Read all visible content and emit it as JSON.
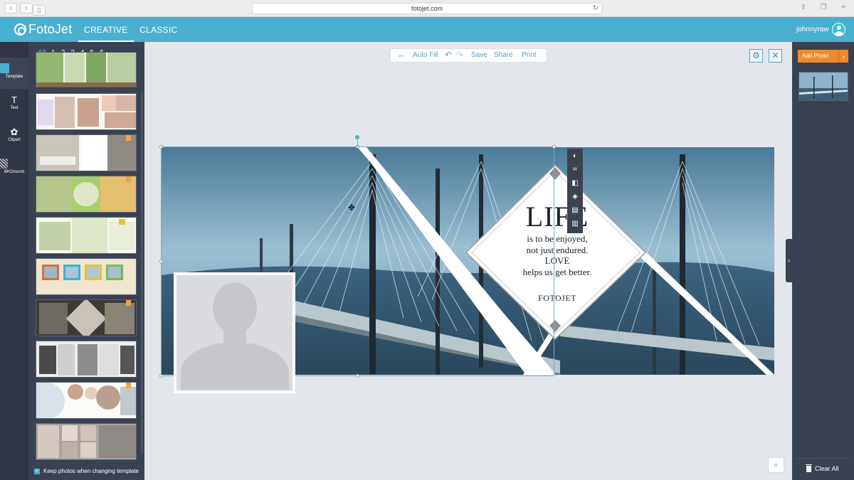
{
  "browser": {
    "url": "fotojet.com"
  },
  "header": {
    "logo": "FotoJet",
    "tabs": [
      {
        "label": "CREATIVE",
        "active": true
      },
      {
        "label": "CLASSIC",
        "active": false
      }
    ],
    "username": "johnnyraw"
  },
  "rail": {
    "items": [
      {
        "label": "Template",
        "icon": "template-icon",
        "active": true
      },
      {
        "label": "Text",
        "icon": "text-icon",
        "glyph": "T"
      },
      {
        "label": "Clipart",
        "icon": "clipart-icon",
        "glyph": "✿"
      },
      {
        "label": "BKGround",
        "icon": "background-icon"
      }
    ]
  },
  "panel": {
    "page_tabs": [
      "All",
      "1",
      "2",
      "3",
      "4",
      "5",
      "6"
    ],
    "keep_photos_label": "Keep photos when changing template",
    "keep_photos_checked": true
  },
  "toolbar": {
    "auto_fill": "Auto Fill",
    "save": "Save",
    "share": "Share",
    "print": "Print"
  },
  "canvas": {
    "quote": {
      "title": "LIFE",
      "lines": [
        "is to be enjoyed,",
        "not just endured.",
        "LOVE",
        "helps us get better."
      ],
      "brand": "FOTOJET"
    },
    "float_tools": [
      "contrast-icon",
      "crop-icon",
      "flip-icon",
      "layers-icon",
      "copy-icon",
      "trash-icon"
    ]
  },
  "right_panel": {
    "add_photo": "Add Photo",
    "clear_all": "Clear All"
  },
  "colors": {
    "header": "#4ab0d2",
    "dark_panel": "#3a4150",
    "rail": "#303643",
    "accent_orange": "#f0892d",
    "canvas_bg": "#e3e6ea"
  }
}
